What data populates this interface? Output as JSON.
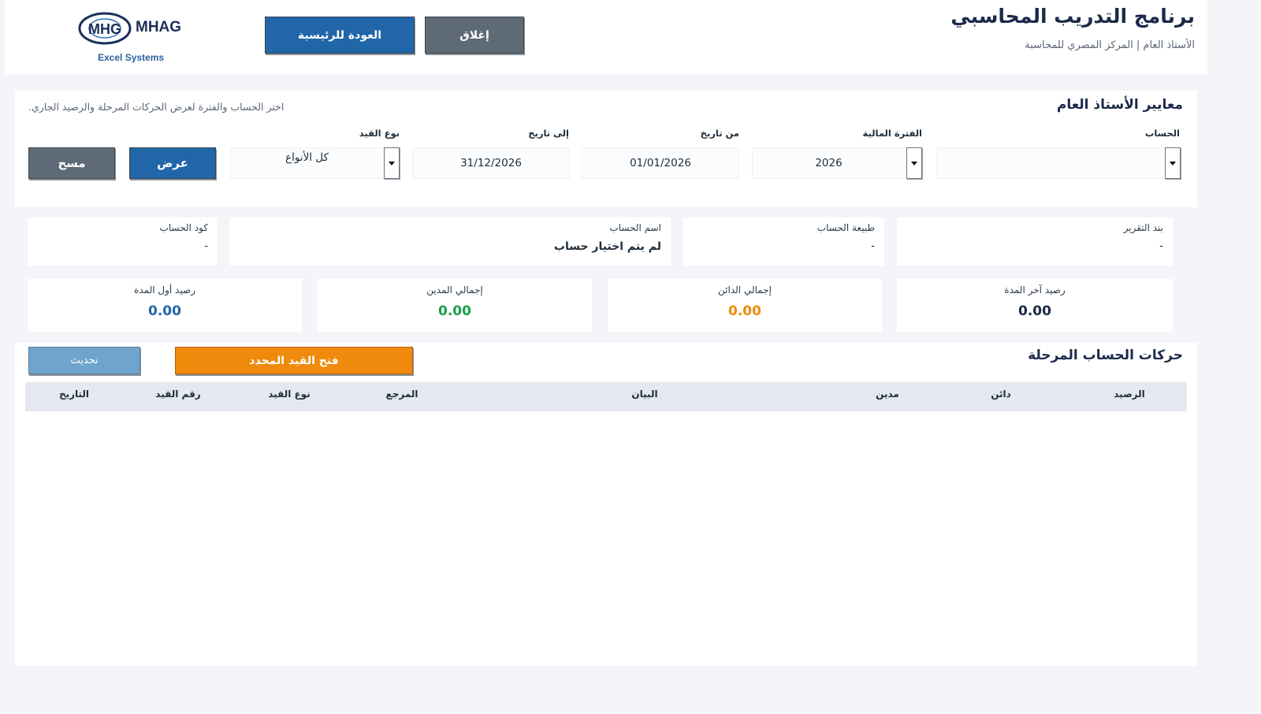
{
  "header": {
    "title": "برنامج التدريب المحاسبي",
    "subtitle": "الأستاذ العام | المركز المصري للمحاسبة",
    "close_label": "إغلاق",
    "home_label": "العودة للرئيسية",
    "logo_text": "MHAG",
    "logo_caption": "Excel Systems"
  },
  "criteria": {
    "title": "معايير الأستاذ العام",
    "hint": "اختر الحساب والفترة لعرض الحركات المرحلة والرصيد الجاري.",
    "account_label": "الحساب",
    "account_value": "",
    "period_label": "الفترة المالية",
    "period_value": "2026",
    "from_label": "من تاريخ",
    "from_value": "01/01/2026",
    "to_label": "إلى تاريخ",
    "to_value": "31/12/2026",
    "type_label": "نوع القيد",
    "type_value": "كل الأنواع",
    "show_label": "عرض",
    "clear_label": "مسح"
  },
  "info": {
    "report_item_label": "بند التقرير",
    "report_item_value": "-",
    "nature_label": "طبيعة الحساب",
    "nature_value": "-",
    "name_label": "اسم الحساب",
    "name_value": "لم يتم اختيار حساب",
    "code_label": "كود الحساب",
    "code_value": "-"
  },
  "summary": {
    "closing_label": "رصيد آخر المدة",
    "closing_value": "0.00",
    "credit_label": "إجمالي الدائن",
    "credit_value": "0.00",
    "debit_label": "إجمالي المدين",
    "debit_value": "0.00",
    "opening_label": "رصيد أول المدة",
    "opening_value": "0.00"
  },
  "movements": {
    "title": "حركات الحساب المرحلة",
    "open_entry_label": "فتح القيد المحدد",
    "refresh_label": "تحديث",
    "columns": {
      "balance": "الرصيد",
      "credit": "دائن",
      "debit": "مدين",
      "description": "البيان",
      "reference": "المرجع",
      "entry_type": "نوع القيد",
      "entry_no": "رقم القيد",
      "date": "التاريخ"
    },
    "rows": []
  },
  "colors": {
    "primary_blue": "#2166a8",
    "slate": "#5e6a75",
    "orange": "#f08a0c",
    "light_blue": "#6ea4cd",
    "green": "#1aa04a",
    "dark_navy": "#1b2a4a"
  }
}
